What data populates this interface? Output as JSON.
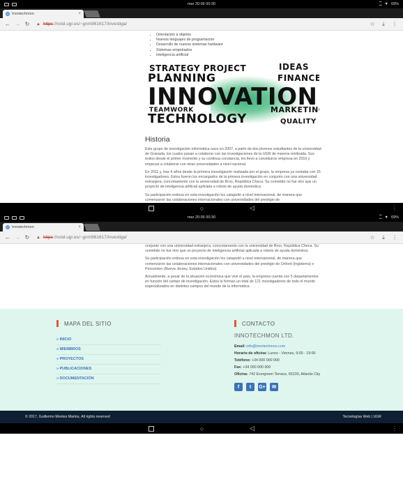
{
  "status": {
    "time": "mar 20:06 00:30",
    "battery": "69%"
  },
  "tab": {
    "title": "Innotechmon",
    "close": "×"
  },
  "omnibox": {
    "scheme": "https",
    "rest": "://void.ugr.es/~gnm961617/investiga/"
  },
  "topics": [
    "Orientación a objetos",
    "Nuevos lenguajes de programación",
    "Desarrollo de nuevos sistemas hardware",
    "Sistemas empotrados",
    "Inteligencia artificial"
  ],
  "banner": {
    "w1": "STRATEGY PROJECT",
    "w2": "IDEAS",
    "w3": "PLANNING",
    "w4": "FINANCE",
    "w5": "INNOVATION",
    "w6": "TEAMWORK",
    "w7": "MARKETING",
    "w8": "TECHNOLOGY",
    "w9": "QUALITY"
  },
  "historia": {
    "heading": "Historia",
    "p1": "Este grupo de investigación informática nace en 2007, a partir de dos jóvenes estudiantes de la universidad de Granada, los cuales pasan a colaborar con las investigaciones de la UGR de manera retribuida. Sus éxitos desde el primer momento y su continua constancia, les llevo a constituirse empresa en 2010 y empezar a colaborar con otras universidades a nivel nacional.",
    "p2": "En 2011 y, tras 4 años desde la primera investigación realizada por el grupo, la empresa ya contaba con 16 investigadores. Estos fueron los encargados de la primera investigación en conjunto con una universidad extranjera, concretamente con la universidad de Brno, República Checa. Su cometido no fue otro que un proyecto de inteligencia artificial aplicada a robots de ayuda doméstica.",
    "p3a": "Su participación exitosa en esta investigación los catapultó a nivel internacional, de manera que comenzaron las colaboraciones internacionales con universidades del prestigio de",
    "p2b": "conjunto con una universidad extranjera, concretamente con la universidad de Brno, República Checa. Su cometido no fue otro que un proyecto de inteligencia artificial aplicada a robots de ayuda doméstica.",
    "p3": "Su participación exitosa en esta investigación los catapultó a nivel internacional, de manera que comenzaron las colaboraciones internacionales con universidades del prestigio de Oxford (Inglaterra) o Princenton (Nueva Jersey, Estados Unidos).",
    "p4": "Actualmente, a pesar de la situación económica que vive el país, la empresa cuenta con 5 departamentos en función del campo de investigación. Estos lo forman un total de 121 investigadores de todo el mundo especializados en distintos campos del mundo de la informática."
  },
  "footer": {
    "map_heading": "MAPA DEL SITIO",
    "links": [
      "» INICIO",
      "» MIEMBROS",
      "» PROYECTOS",
      "» PUBLICACIONES",
      "» DOCUMENTACIÓN"
    ],
    "contact_heading": "CONTACTO",
    "company": "INNOTECHMON LTD.",
    "email_label": "Email:",
    "email": "info@innotechmon.com",
    "hours_label": "Horario de oficina:",
    "hours": "Lunes - Viernes, 9:00 - 19:00",
    "phone_label": "Teléfono:",
    "phone": "+34 000 000 000",
    "fax_label": "Fax:",
    "fax": "+34 000 000 000",
    "office_label": "Oficina:",
    "office": "742 Evergreen Terrace, 65230, Atlantis City",
    "social": [
      "f",
      "t",
      "G+",
      "✉"
    ]
  },
  "copyright": {
    "left": "© 2017, Guillermo Montes Martos, All rights reserved",
    "right": "Tecnologías Web | UGR"
  }
}
